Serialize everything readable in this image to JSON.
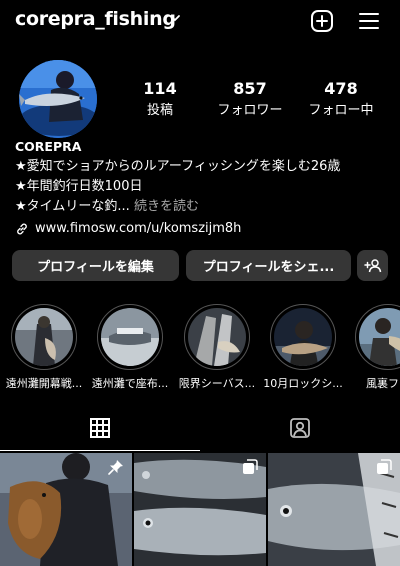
{
  "header": {
    "username": "corepra_fishing",
    "icons": {
      "dropdown": "chevron-down-icon",
      "create": "plus-square-icon",
      "menu": "hamburger-menu-icon"
    }
  },
  "profile": {
    "stats": [
      {
        "value": "114",
        "label": "投稿"
      },
      {
        "value": "857",
        "label": "フォロワー"
      },
      {
        "value": "478",
        "label": "フォロー中"
      }
    ]
  },
  "bio": {
    "name": "COREPRA",
    "lines": [
      "★愛知でショアからのルアーフィッシングを楽しむ26歳",
      "★年間釣行日数100日"
    ],
    "truncated_line": "★タイムリーな釣...",
    "more_label": "続きを読む",
    "link": "www.fimosw.com/u/komszijm8h"
  },
  "actions": {
    "edit_label": "プロフィールを編集",
    "share_label": "プロフィールをシェ...",
    "suggest_icon": "add-person-icon"
  },
  "highlights": [
    {
      "title": "遠州灘開幕戦..."
    },
    {
      "title": "遠州灘で座布..."
    },
    {
      "title": "限界シーバス..."
    },
    {
      "title": "10月ロックシ..."
    },
    {
      "title": "風裏フラ"
    }
  ],
  "tabs": [
    {
      "icon": "grid-icon",
      "active": true
    },
    {
      "icon": "tagged-person-icon",
      "active": false
    }
  ],
  "posts": [
    {
      "badge": "pin-icon"
    },
    {
      "badge": "multiple-photos-icon"
    },
    {
      "badge": "multiple-photos-icon"
    }
  ]
}
